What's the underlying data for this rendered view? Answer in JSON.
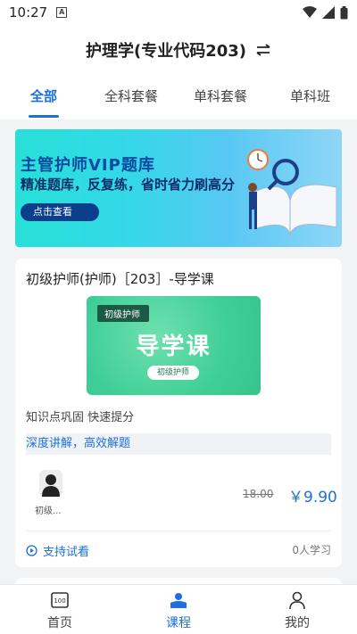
{
  "status_bar": {
    "time": "10:27",
    "a_icon_letter": "A"
  },
  "header": {
    "title": "护理学(专业代码203)",
    "switch_icon": "switch-arrows-icon"
  },
  "tabs": [
    {
      "label": "全部",
      "active": true
    },
    {
      "label": "全科套餐",
      "active": false
    },
    {
      "label": "单科套餐",
      "active": false
    },
    {
      "label": "单科班",
      "active": false
    }
  ],
  "banner": {
    "title": "主管护师VIP题库",
    "subtitle": "精准题库，反复练，省时省力刷高分",
    "button": "点击查看"
  },
  "course": {
    "title": "初级护师(护师)［203］-导学课",
    "thumb_tag": "初级护师",
    "thumb_main": "导学课",
    "thumb_pill": "初级护师",
    "description": "知识点巩固 快速提分",
    "highlight": "深度讲解，高效解题",
    "teacher_name": "初级...",
    "old_price": "18.00",
    "new_price": "￥9.90",
    "trial_label": "支持试看",
    "learners": "0人学习"
  },
  "bottom_nav": [
    {
      "label": "首页",
      "icon": "home-icon",
      "active": false
    },
    {
      "label": "课程",
      "icon": "course-icon",
      "active": true
    },
    {
      "label": "我的",
      "icon": "profile-icon",
      "active": false
    }
  ],
  "colors": {
    "accent": "#1e6fe0",
    "banner_start": "#27e0d8",
    "thumb_green": "#3fcf96"
  }
}
